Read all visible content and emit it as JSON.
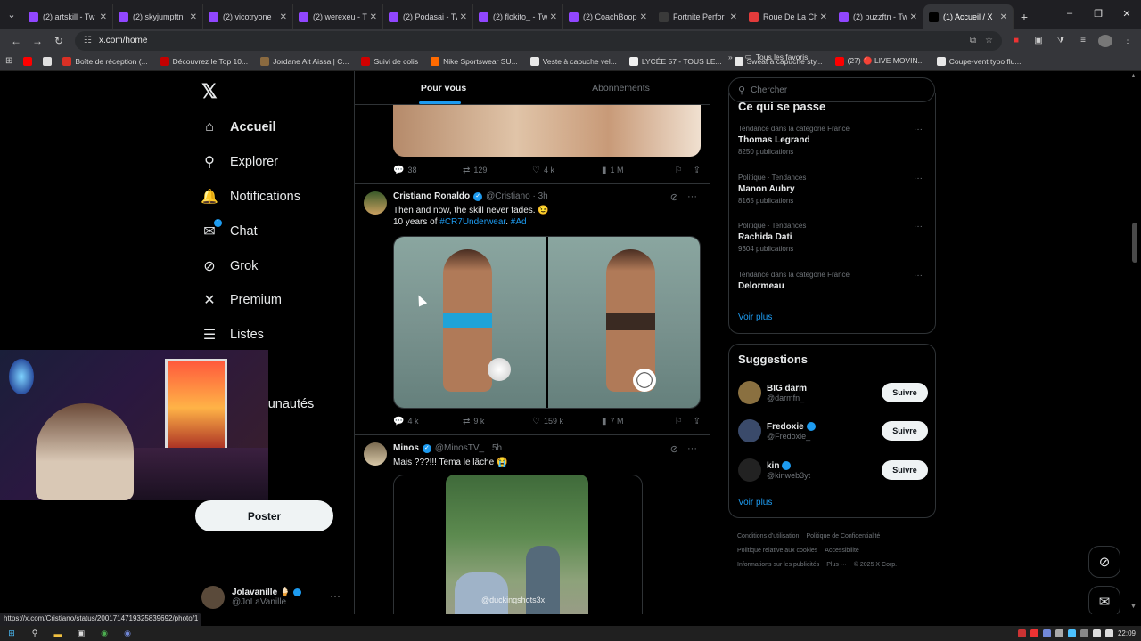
{
  "tabs": [
    {
      "label": "(2) artskill - Tw",
      "color": "#9146ff"
    },
    {
      "label": "(2) skyjumpftn",
      "color": "#9146ff"
    },
    {
      "label": "(2) vicotryone",
      "color": "#9146ff"
    },
    {
      "label": "(2) werexeu - T",
      "color": "#9146ff"
    },
    {
      "label": "(2) Podasai - Tw",
      "color": "#9146ff"
    },
    {
      "label": "(2) flokito_ - Tw",
      "color": "#9146ff"
    },
    {
      "label": "(2) CoachBoop",
      "color": "#9146ff"
    },
    {
      "label": "Fortnite Perfor",
      "color": "#3a3a3a"
    },
    {
      "label": "Roue De La Ch",
      "color": "#e23b3b"
    },
    {
      "label": "(2) buzzftn - Tw",
      "color": "#9146ff"
    },
    {
      "label": "(1) Accueil / X",
      "color": "#000000",
      "active": true
    }
  ],
  "address": {
    "url": "x.com/home"
  },
  "bookmarks": [
    {
      "label": "",
      "color": "#ff0000"
    },
    {
      "label": "",
      "color": "#e0e0e0"
    },
    {
      "label": "Boîte de réception (...",
      "color": "#d93025"
    },
    {
      "label": "Découvrez le Top 10...",
      "color": "#c40000"
    },
    {
      "label": "Jordane Ait Aissa | C...",
      "color": "#8a6a40"
    },
    {
      "label": "Suivi de colis",
      "color": "#d00000"
    },
    {
      "label": "Nike Sportswear SU...",
      "color": "#ff6a00"
    },
    {
      "label": "Veste à capuche vel...",
      "color": "#e8e8e8"
    },
    {
      "label": "LYCÉE 57 - TOUS LE...",
      "color": "#f0f0f0"
    },
    {
      "label": "Sweat à capuche sty...",
      "color": "#e8e8e8"
    },
    {
      "label": "(27) 🔴 LIVE MOVIN...",
      "color": "#ff0000"
    },
    {
      "label": "Coupe-vent typo flu...",
      "color": "#e8e8e8"
    }
  ],
  "bookmarks_all": "Tous les favoris",
  "nav": {
    "items": [
      {
        "label": "Accueil",
        "icon": "home-icon",
        "glyph": "⌂"
      },
      {
        "label": "Explorer",
        "icon": "search-icon",
        "glyph": "⚲"
      },
      {
        "label": "Notifications",
        "icon": "bell-icon",
        "glyph": "🔔"
      },
      {
        "label": "Chat",
        "icon": "mail-icon",
        "glyph": "✉",
        "badge": "1"
      },
      {
        "label": "Grok",
        "icon": "grok-icon",
        "glyph": "⊘"
      },
      {
        "label": "Premium",
        "icon": "x-icon",
        "glyph": "✕"
      },
      {
        "label": "Listes",
        "icon": "list-icon",
        "glyph": "☰"
      },
      {
        "label": "Communautés",
        "icon": "communities-icon",
        "glyph": "👥"
      }
    ],
    "post_label": "Poster",
    "account_name": "Jolavanille 🍦",
    "account_handle": "@JoLaVanille"
  },
  "feed": {
    "tabs": [
      "Pour vous",
      "Abonnements"
    ],
    "prev_actions": {
      "replies": "38",
      "reposts": "129",
      "likes": "4 k",
      "views": "1 M"
    },
    "tweet1": {
      "name": "Cristiano Ronaldo",
      "handle": "@Cristiano · 3h",
      "text_line1": "Then and now, the skill never fades. 😉",
      "text_line2_a": "10 years of ",
      "text_line2_link1": "#CR7Underwear",
      "text_line2_b": ". ",
      "text_line2_link2": "#Ad",
      "replies": "4 k",
      "reposts": "9 k",
      "likes": "159 k",
      "views": "7 M"
    },
    "tweet2": {
      "name": "Minos",
      "handle": "@MinosTV_ · 5h",
      "text": "Mais ???!!! Tema le lâche 😭",
      "watermark": "@duckingshots3x"
    }
  },
  "right": {
    "search_placeholder": "Chercher",
    "trends_title": "Ce qui se passe",
    "trends": [
      {
        "context": "Tendance dans la catégorie France",
        "topic": "Thomas Legrand",
        "posts": "8250 publications"
      },
      {
        "context": "Politique · Tendances",
        "topic": "Manon Aubry",
        "posts": "8165 publications"
      },
      {
        "context": "Politique · Tendances",
        "topic": "Rachida Dati",
        "posts": "9304 publications"
      },
      {
        "context": "Tendance dans la catégorie France",
        "topic": "Delormeau",
        "posts": ""
      }
    ],
    "see_more": "Voir plus",
    "sugg_title": "Suggestions",
    "suggestions": [
      {
        "name": "BIG darm",
        "handle": "@darmfn_",
        "verified": false,
        "color": "#8a7040"
      },
      {
        "name": "Fredoxie",
        "handle": "@Fredoxie_",
        "verified": true,
        "color": "#3a4a6a"
      },
      {
        "name": "kin",
        "handle": "@kinweb3yt",
        "verified": true,
        "color": "#222222"
      }
    ],
    "follow_label": "Suivre",
    "footer": [
      "Conditions d'utilisation",
      "Politique de Confidentialité",
      "Politique relative aux cookies",
      "Accessibilité",
      "Informations sur les publicités",
      "Plus ···",
      "© 2025 X Corp."
    ]
  },
  "status_url": "https://x.com/Cristiano/status/2001714719325839692/photo/1",
  "clock": "22:09"
}
